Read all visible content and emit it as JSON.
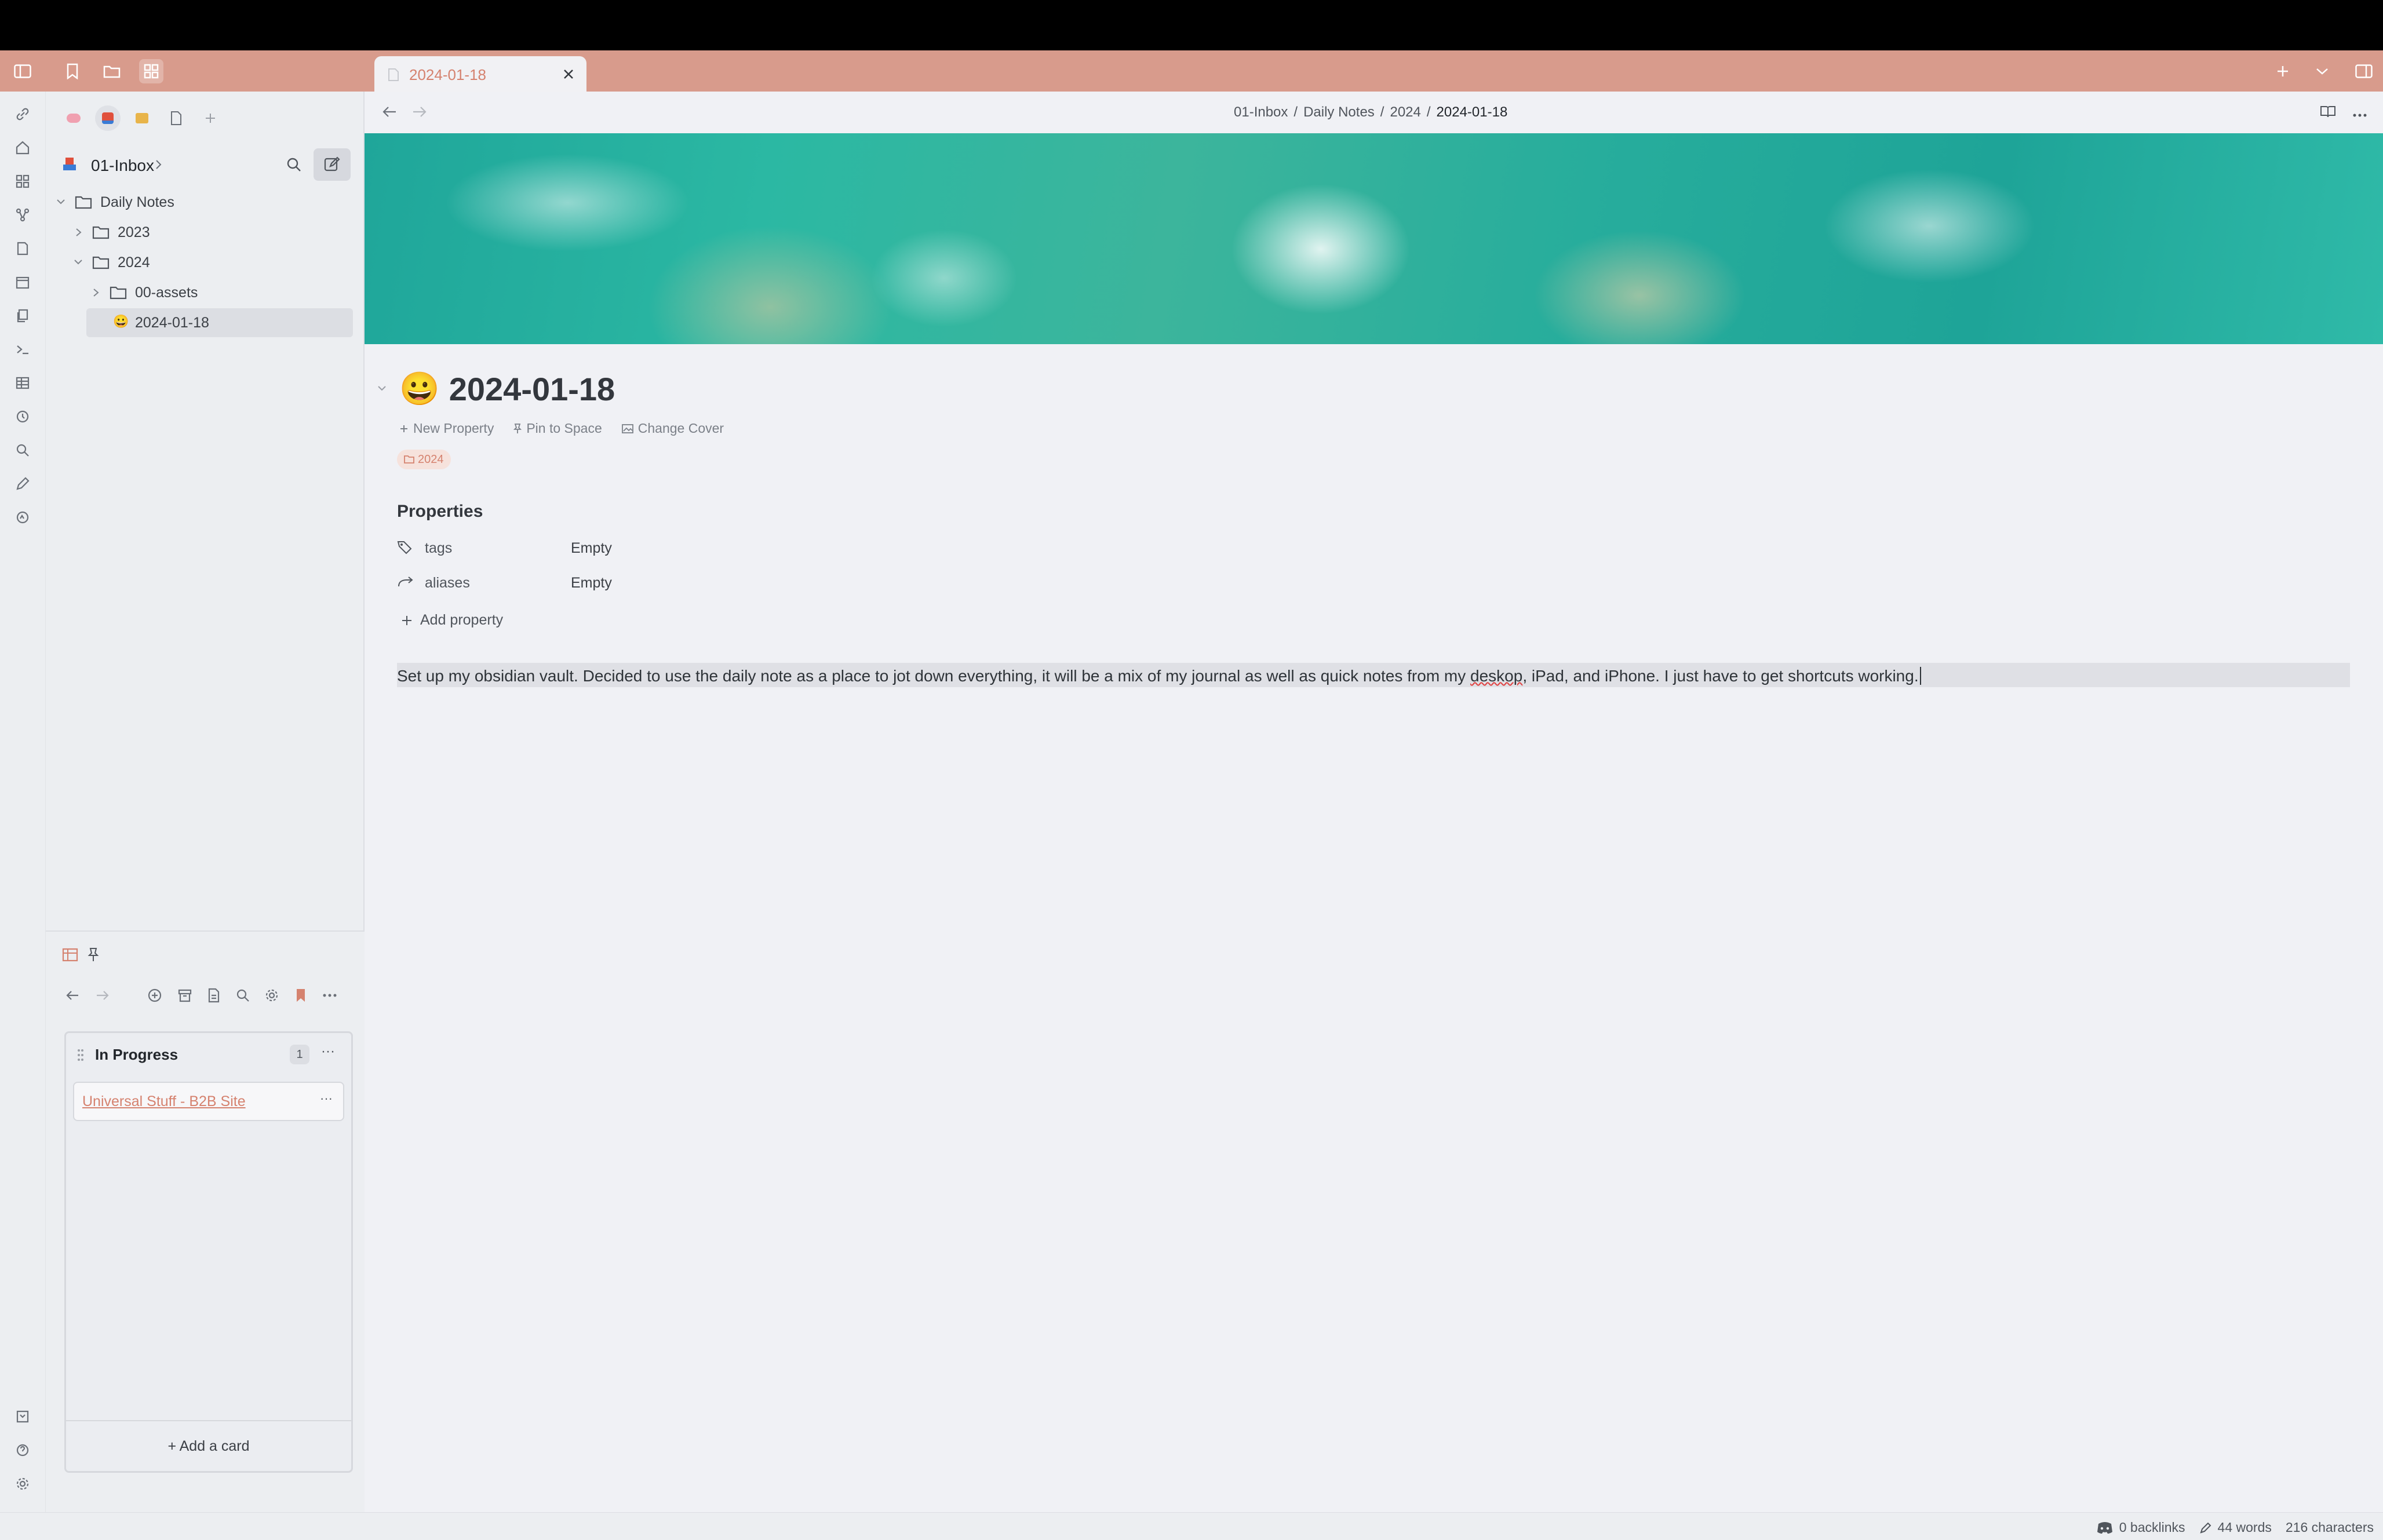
{
  "tab": {
    "title": "2024-01-18",
    "close_label": "✕"
  },
  "sidebar": {
    "vault_name": "01-Inbox",
    "tree": [
      {
        "label": "Daily Notes"
      },
      {
        "label": "2023"
      },
      {
        "label": "2024"
      },
      {
        "label": "00-assets"
      },
      {
        "label": "2024-01-18"
      }
    ]
  },
  "kanban": {
    "lane_title": "In Progress",
    "lane_count": "1",
    "card_title": "Universal Stuff - B2B Site",
    "add_card": "+ Add a card",
    "more_label": "···"
  },
  "breadcrumb": {
    "p1": "01-Inbox",
    "p2": "Daily Notes",
    "p3": "2024",
    "p4": "2024-01-18",
    "sep": "/"
  },
  "note": {
    "emoji": "😀",
    "title": "2024-01-18",
    "new_property": "New Property",
    "pin_to_space": "Pin to Space",
    "change_cover": "Change Cover",
    "folder_chip": "2024",
    "properties_heading": "Properties",
    "prop_tags_key": "tags",
    "prop_tags_value": "Empty",
    "prop_aliases_key": "aliases",
    "prop_aliases_value": "Empty",
    "add_property": "Add property",
    "body_before": "Set up my obsidian vault. Decided to use the daily note as a place to jot down everything, it will be a mix of my journal as well as quick notes from my ",
    "body_misspelled": "deskop",
    "body_after": ", iPad, and iPhone. I just have to get shortcuts working."
  },
  "status": {
    "backlinks": "0 backlinks",
    "words": "44 words",
    "characters": "216 characters"
  },
  "colors": {
    "accent": "#d5826f",
    "tabbar": "#d89b8c",
    "background": "#f0f1f5"
  }
}
